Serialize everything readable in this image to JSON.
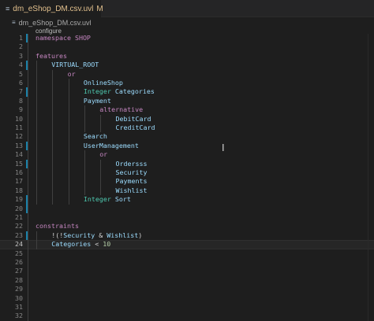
{
  "tab": {
    "icon": "≡",
    "name": "dm_eShop_DM.csv.uvl",
    "state": "M"
  },
  "breadcrumb": {
    "icon": "≡",
    "file": "dm_eShop_DM.csv.uvl"
  },
  "codelens": "configure",
  "lines": [
    {
      "n": "1",
      "tokens": [
        {
          "t": "namespace SHOP",
          "c": "kw"
        }
      ],
      "indent": 0,
      "bar": true
    },
    {
      "n": "2",
      "tokens": [],
      "indent": 0
    },
    {
      "n": "3",
      "tokens": [
        {
          "t": "features",
          "c": "kw"
        }
      ],
      "indent": 0
    },
    {
      "n": "4",
      "tokens": [
        {
          "t": "VIRTUAL_ROOT",
          "c": "id"
        }
      ],
      "indent": 1,
      "bar": true
    },
    {
      "n": "5",
      "tokens": [
        {
          "t": "or",
          "c": "kw"
        }
      ],
      "indent": 2
    },
    {
      "n": "6",
      "tokens": [
        {
          "t": "OnlineShop",
          "c": "id"
        }
      ],
      "indent": 3
    },
    {
      "n": "7",
      "tokens": [
        {
          "t": "Integer ",
          "c": "ty"
        },
        {
          "t": "Categories",
          "c": "id"
        }
      ],
      "indent": 3,
      "bar": true
    },
    {
      "n": "8",
      "tokens": [
        {
          "t": "Payment",
          "c": "id"
        }
      ],
      "indent": 3
    },
    {
      "n": "9",
      "tokens": [
        {
          "t": "alternative",
          "c": "kw"
        }
      ],
      "indent": 4
    },
    {
      "n": "10",
      "tokens": [
        {
          "t": "DebitCard",
          "c": "id"
        }
      ],
      "indent": 5
    },
    {
      "n": "11",
      "tokens": [
        {
          "t": "CreditCard",
          "c": "id"
        }
      ],
      "indent": 5
    },
    {
      "n": "12",
      "tokens": [
        {
          "t": "Search",
          "c": "id"
        }
      ],
      "indent": 3
    },
    {
      "n": "13",
      "tokens": [
        {
          "t": "UserManagement",
          "c": "id"
        }
      ],
      "indent": 3,
      "bar": true
    },
    {
      "n": "14",
      "tokens": [
        {
          "t": "or",
          "c": "kw"
        }
      ],
      "indent": 4
    },
    {
      "n": "15",
      "tokens": [
        {
          "t": "Ordersss",
          "c": "id"
        }
      ],
      "indent": 5,
      "bar": true
    },
    {
      "n": "16",
      "tokens": [
        {
          "t": "Security",
          "c": "id"
        }
      ],
      "indent": 5
    },
    {
      "n": "17",
      "tokens": [
        {
          "t": "Payments",
          "c": "id"
        }
      ],
      "indent": 5
    },
    {
      "n": "18",
      "tokens": [
        {
          "t": "Wishlist",
          "c": "id"
        }
      ],
      "indent": 5
    },
    {
      "n": "19",
      "tokens": [
        {
          "t": "Integer ",
          "c": "ty"
        },
        {
          "t": "Sort",
          "c": "id"
        }
      ],
      "indent": 3,
      "bar": true
    },
    {
      "n": "20",
      "tokens": [],
      "indent": 0,
      "bar": true
    },
    {
      "n": "21",
      "tokens": [],
      "indent": 0
    },
    {
      "n": "22",
      "tokens": [
        {
          "t": "constraints",
          "c": "kw"
        }
      ],
      "indent": 0
    },
    {
      "n": "23",
      "tokens": [
        {
          "t": "!(!",
          "c": "op"
        },
        {
          "t": "Security",
          "c": "id"
        },
        {
          "t": " & ",
          "c": "op"
        },
        {
          "t": "Wishlist",
          "c": "id"
        },
        {
          "t": ")",
          "c": "op"
        }
      ],
      "indent": 1,
      "bar": true
    },
    {
      "n": "24",
      "tokens": [
        {
          "t": "Categories",
          "c": "id"
        },
        {
          "t": " < ",
          "c": "op"
        },
        {
          "t": "10",
          "c": "num"
        }
      ],
      "indent": 1,
      "current": true
    },
    {
      "n": "25",
      "tokens": [],
      "indent": 0
    },
    {
      "n": "26",
      "tokens": [],
      "indent": 0
    },
    {
      "n": "27",
      "tokens": [],
      "indent": 0
    },
    {
      "n": "28",
      "tokens": [],
      "indent": 0
    },
    {
      "n": "29",
      "tokens": [],
      "indent": 0
    },
    {
      "n": "30",
      "tokens": [],
      "indent": 0
    },
    {
      "n": "31",
      "tokens": [],
      "indent": 0
    },
    {
      "n": "32",
      "tokens": [],
      "indent": 0
    }
  ]
}
